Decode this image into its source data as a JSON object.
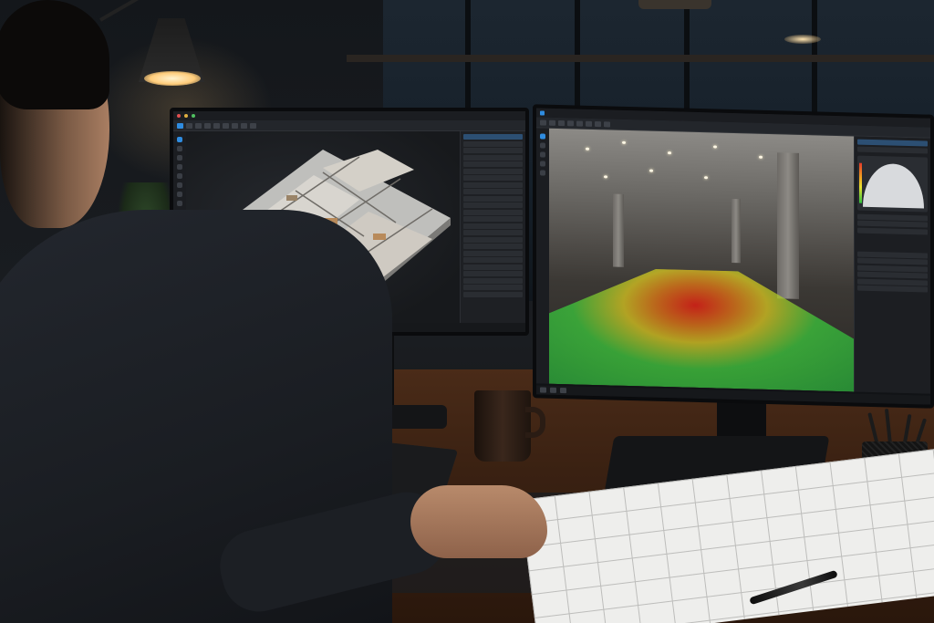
{
  "scene": {
    "description_colors": {
      "wall": "#14171b",
      "desk": "#3a2112",
      "screen_bg": "#17191c",
      "accent_blue": "#2f8ce0",
      "heat_red": "#dc1e14",
      "heat_yellow": "#e6d21e",
      "heat_green": "#3cc83c"
    },
    "objects": [
      "desk-lamp-icon",
      "plant-icon",
      "architectural-model-icon",
      "keyboard-icon",
      "mouse-icon",
      "coffee-mug-icon",
      "pen-cup-icon",
      "floor-plan-paper-icon",
      "pen-icon"
    ]
  },
  "left_monitor": {
    "left_rail_items": 9,
    "panel_rows": 24,
    "selected_row": 2
  },
  "right_monitor": {
    "heatmap_legend": [
      "#e23a2a",
      "#f0a020",
      "#e8e030",
      "#30c040"
    ]
  }
}
